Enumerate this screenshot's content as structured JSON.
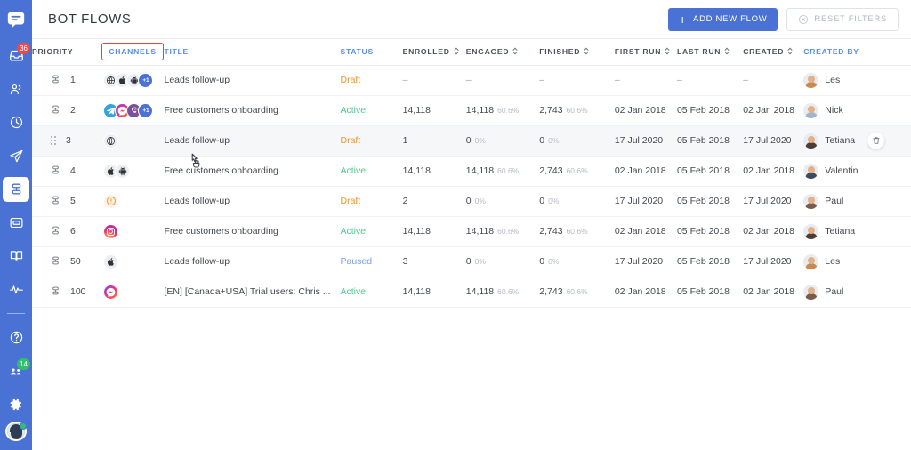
{
  "sidebar": {
    "logo_icon": "chat-bubble-logo",
    "items": [
      {
        "name": "inbox",
        "icon": "inbox-icon",
        "badge": "36",
        "badge_color": "#f0484a",
        "active": false
      },
      {
        "name": "contacts",
        "icon": "people-icon",
        "badge": "",
        "badge_color": "",
        "active": false
      },
      {
        "name": "history",
        "icon": "clock-icon",
        "badge": "",
        "badge_color": "",
        "active": false
      },
      {
        "name": "broadcast",
        "icon": "paper-plane-icon",
        "badge": "",
        "badge_color": "",
        "active": false
      },
      {
        "name": "flows",
        "icon": "flows-icon",
        "badge": "",
        "badge_color": "",
        "active": true
      },
      {
        "name": "widgets",
        "icon": "window-icon",
        "badge": "",
        "badge_color": "",
        "active": false
      },
      {
        "name": "knowledge",
        "icon": "book-icon",
        "badge": "",
        "badge_color": "",
        "active": false
      },
      {
        "name": "analytics",
        "icon": "pulse-icon",
        "badge": "",
        "badge_color": "",
        "active": false
      }
    ],
    "bottom_items": [
      {
        "name": "help",
        "icon": "question-circle-icon",
        "badge": "",
        "badge_color": ""
      },
      {
        "name": "team",
        "icon": "team-icon",
        "badge": "14",
        "badge_color": "#2fbf6d"
      },
      {
        "name": "settings",
        "icon": "gear-icon",
        "badge": "",
        "badge_color": ""
      }
    ],
    "avatar": {
      "name": "user-avatar",
      "status": "online"
    },
    "accent": "#4a72d4"
  },
  "header": {
    "title": "BOT FLOWS",
    "add_flow_label": "ADD NEW FLOW",
    "add_flow_icon": "plus-icon",
    "reset_filters_label": "RESET FILTERS",
    "reset_filters_icon": "x-circle-icon"
  },
  "table": {
    "columns": [
      {
        "key": "priority",
        "label": "PRIORITY",
        "sortable": false,
        "accent": false,
        "highlighted": false
      },
      {
        "key": "channels",
        "label": "CHANNELS",
        "sortable": false,
        "accent": true,
        "highlighted": true
      },
      {
        "key": "title",
        "label": "TITLE",
        "sortable": false,
        "accent": true,
        "highlighted": false
      },
      {
        "key": "status",
        "label": "STATUS",
        "sortable": false,
        "accent": true,
        "highlighted": false
      },
      {
        "key": "enrolled",
        "label": "ENROLLED",
        "sortable": true,
        "accent": false,
        "highlighted": false
      },
      {
        "key": "engaged",
        "label": "ENGAGED",
        "sortable": true,
        "accent": false,
        "highlighted": false
      },
      {
        "key": "finished",
        "label": "FINISHED",
        "sortable": true,
        "accent": false,
        "highlighted": false
      },
      {
        "key": "first_run",
        "label": "FIRST RUN",
        "sortable": true,
        "accent": false,
        "highlighted": false
      },
      {
        "key": "last_run",
        "label": "LAST RUN",
        "sortable": true,
        "accent": false,
        "highlighted": false
      },
      {
        "key": "created",
        "label": "CREATED",
        "sortable": true,
        "accent": false,
        "highlighted": false
      },
      {
        "key": "created_by",
        "label": "CREATED BY",
        "sortable": false,
        "accent": true,
        "highlighted": false
      }
    ],
    "rows": [
      {
        "priority": "1",
        "handle": "list-icon",
        "channels": [
          "web",
          "apple",
          "android",
          "plus1"
        ],
        "title": "Leads follow-up",
        "status": "Draft",
        "status_kind": "draft",
        "enrolled": "–",
        "engaged": "–",
        "engaged_pct": "",
        "finished": "–",
        "finished_pct": "",
        "first_run": "–",
        "last_run": "–",
        "created": "–",
        "created_by": "Les",
        "avatar_color": "#c98a52",
        "hovered": false
      },
      {
        "priority": "2",
        "handle": "list-icon",
        "channels": [
          "telegram",
          "messenger",
          "viber",
          "plus1"
        ],
        "title": "Free customers onboarding",
        "status": "Active",
        "status_kind": "active",
        "enrolled": "14,118",
        "engaged": "14,118",
        "engaged_pct": "60.6%",
        "finished": "2,743",
        "finished_pct": "60.6%",
        "first_run": "02 Jan 2018",
        "last_run": "05 Feb 2018",
        "created": "02 Jan 2018",
        "created_by": "Nick",
        "avatar_color": "#9fb6cd",
        "hovered": false
      },
      {
        "priority": "3",
        "handle": "drag-handle",
        "channels": [
          "web"
        ],
        "title": "Leads follow-up",
        "status": "Draft",
        "status_kind": "draft",
        "enrolled": "1",
        "engaged": "0",
        "engaged_pct": "0%",
        "finished": "0",
        "finished_pct": "0%",
        "first_run": "17 Jul 2020",
        "last_run": "05 Feb 2018",
        "created": "17 Jul 2020",
        "created_by": "Tetiana",
        "avatar_color": "#4e3b34",
        "hovered": true
      },
      {
        "priority": "4",
        "handle": "list-icon",
        "channels": [
          "apple",
          "android"
        ],
        "title": "Free customers onboarding",
        "status": "Active",
        "status_kind": "active",
        "enrolled": "14,118",
        "engaged": "14,118",
        "engaged_pct": "60.6%",
        "finished": "2,743",
        "finished_pct": "60.6%",
        "first_run": "02 Jan 2018",
        "last_run": "05 Feb 2018",
        "created": "02 Jan 2018",
        "created_by": "Valentin",
        "avatar_color": "#3b4a5c",
        "hovered": false
      },
      {
        "priority": "5",
        "handle": "list-icon",
        "channels": [
          "alert"
        ],
        "title": "Leads follow-up",
        "status": "Draft",
        "status_kind": "draft",
        "enrolled": "2",
        "engaged": "0",
        "engaged_pct": "0%",
        "finished": "0",
        "finished_pct": "0%",
        "first_run": "17 Jul 2020",
        "last_run": "05 Feb 2018",
        "created": "17 Jul 2020",
        "created_by": "Paul",
        "avatar_color": "#7a5b47",
        "hovered": false
      },
      {
        "priority": "6",
        "handle": "list-icon",
        "channels": [
          "instagram"
        ],
        "title": "Free customers onboarding",
        "status": "Active",
        "status_kind": "active",
        "enrolled": "14,118",
        "engaged": "14,118",
        "engaged_pct": "60.6%",
        "finished": "2,743",
        "finished_pct": "60.6%",
        "first_run": "02 Jan 2018",
        "last_run": "05 Feb 2018",
        "created": "02 Jan 2018",
        "created_by": "Tetiana",
        "avatar_color": "#4e3b34",
        "hovered": false
      },
      {
        "priority": "50",
        "handle": "list-icon",
        "channels": [
          "apple"
        ],
        "title": "Leads follow-up",
        "status": "Paused",
        "status_kind": "paused",
        "enrolled": "3",
        "engaged": "0",
        "engaged_pct": "0%",
        "finished": "0",
        "finished_pct": "0%",
        "first_run": "17 Jul 2020",
        "last_run": "05 Feb 2018",
        "created": "17 Jul 2020",
        "created_by": "Les",
        "avatar_color": "#c98a52",
        "hovered": false
      },
      {
        "priority": "100",
        "handle": "list-icon",
        "channels": [
          "messenger"
        ],
        "title": "[EN] [Canada+USA] Trial users: Chris ...",
        "status": "Active",
        "status_kind": "active",
        "enrolled": "14,118",
        "engaged": "14,118",
        "engaged_pct": "60.6%",
        "finished": "2,743",
        "finished_pct": "60.6%",
        "first_run": "02 Jan 2018",
        "last_run": "05 Feb 2018",
        "created": "02 Jan 2018",
        "created_by": "Paul",
        "avatar_color": "#7a5b47",
        "hovered": false
      }
    ],
    "row_actions": {
      "delete_icon": "trash-icon"
    }
  },
  "colors": {
    "accent": "#4a72d4",
    "link": "#5b8def",
    "draft": "#f0932b",
    "active": "#4ecb8b",
    "paused": "#7aa0ec",
    "highlight_border": "#e8403a"
  }
}
